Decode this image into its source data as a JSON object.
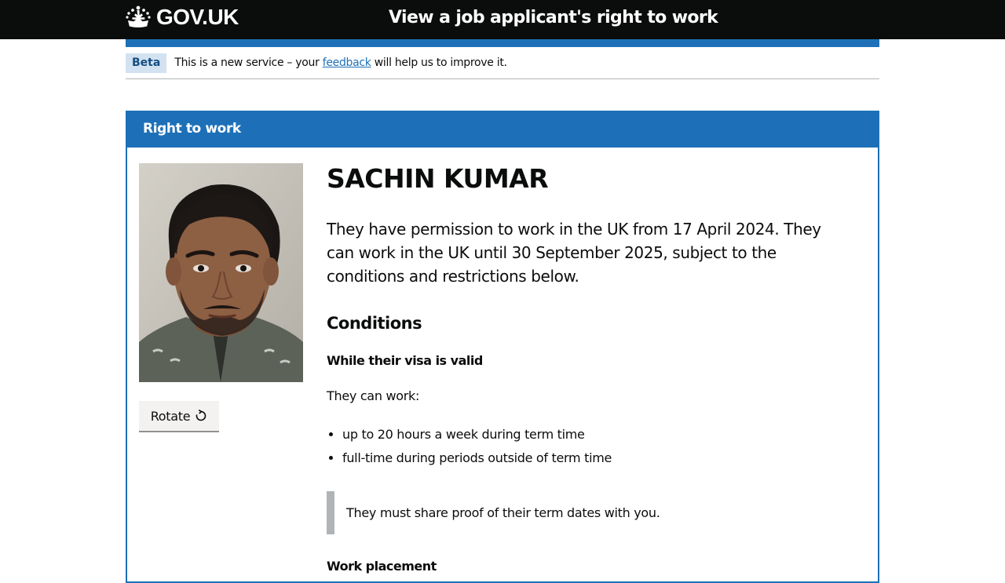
{
  "header": {
    "logo_text": "GOV.UK",
    "logo_icon": "crown-icon",
    "service_name": "View a job applicant's right to work"
  },
  "phase_banner": {
    "tag": "Beta",
    "text_before": "This is a new service – your ",
    "link_text": "feedback",
    "text_after": " will help us to improve it."
  },
  "panel": {
    "title": "Right to work",
    "rotate_button": "Rotate",
    "rotate_icon": "rotate-clockwise-icon",
    "name": "SACHIN KUMAR",
    "summary": "They have permission to work in the UK from 17 April 2024. They can work in the UK until 30 September 2025, subject to the conditions and restrictions below.",
    "conditions_heading": "Conditions",
    "visa_heading": "While their visa is valid",
    "can_work": "They can work:",
    "bullets": [
      "up to 20 hours a week during term time",
      "full-time during periods outside of term time"
    ],
    "inset": "They must share proof of their term dates with you.",
    "next_heading": "Work placement"
  },
  "colors": {
    "header_bg": "#0b0c0c",
    "brand_blue": "#1d70b8",
    "link": "#1d70b8",
    "tag_bg": "#d2e2f1",
    "tag_text": "#144e81",
    "inset_border": "#b1b4b6"
  }
}
